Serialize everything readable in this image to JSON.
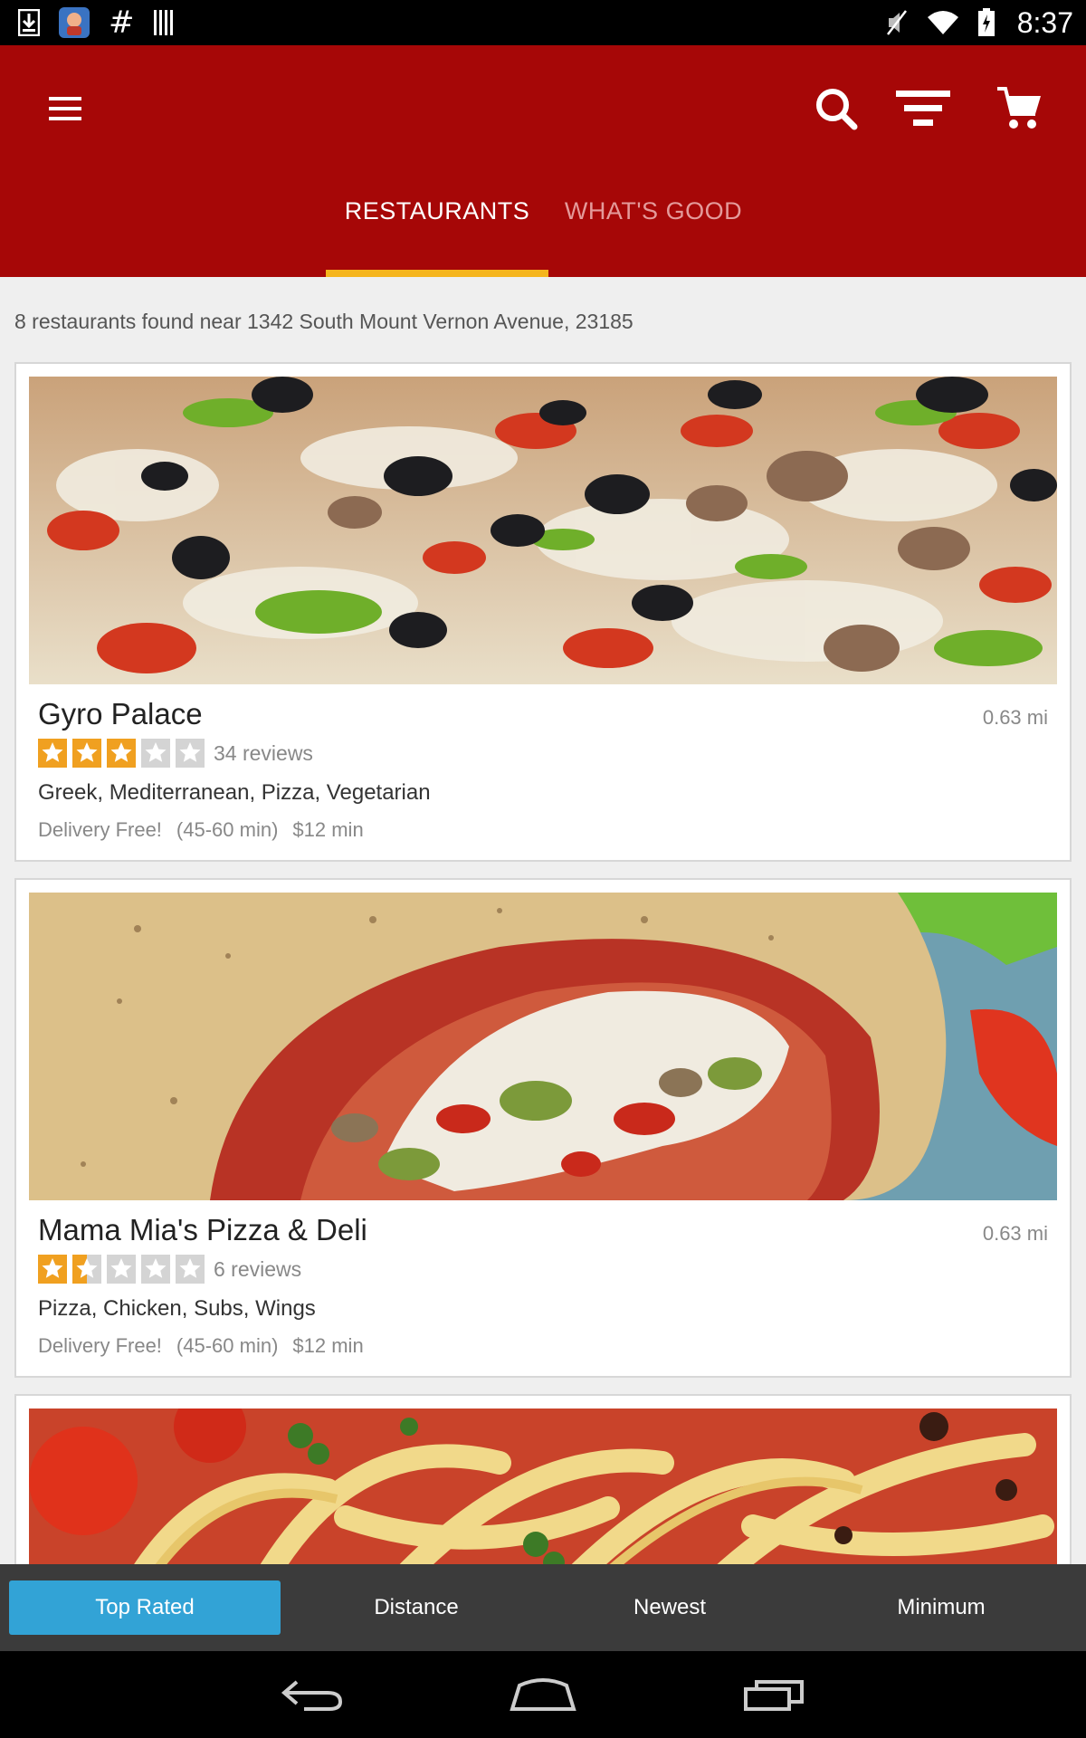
{
  "status_bar": {
    "time": "8:37",
    "icons": [
      "download-icon",
      "app-icon",
      "hash-icon",
      "barcode-icon",
      "mute-icon",
      "wifi-icon",
      "battery-icon"
    ]
  },
  "app_bar": {
    "background": "#a60707",
    "accent": "#f5b51d",
    "icons": [
      "menu-icon",
      "search-icon",
      "filter-icon",
      "cart-icon"
    ],
    "tabs": [
      {
        "label": "RESTAURANTS",
        "selected": true
      },
      {
        "label": "WHAT'S GOOD",
        "selected": false
      }
    ]
  },
  "results_summary": "8 restaurants found near 1342 South Mount Vernon Avenue, 23185",
  "restaurants": [
    {
      "name": "Gyro Palace",
      "distance": "0.63 mi",
      "rating": 3,
      "rating_max": 5,
      "reviews": "34 reviews",
      "cuisines": "Greek, Mediterranean, Pizza, Vegetarian",
      "delivery": "Delivery Free!",
      "time": "(45-60 min)",
      "minimum": "$12 min",
      "photo": "pizza-photo"
    },
    {
      "name": "Mama Mia's Pizza & Deli",
      "distance": "0.63 mi",
      "rating": 1.5,
      "rating_max": 5,
      "reviews": "6 reviews",
      "cuisines": "Pizza, Chicken, Subs, Wings",
      "delivery": "Delivery Free!",
      "time": "(45-60 min)",
      "minimum": "$12 min",
      "photo": "stromboli-photo"
    },
    {
      "photo": "pasta-photo"
    }
  ],
  "sort_bar": {
    "options": [
      {
        "label": "Top Rated",
        "selected": true
      },
      {
        "label": "Distance",
        "selected": false
      },
      {
        "label": "Newest",
        "selected": false
      },
      {
        "label": "Minimum",
        "selected": false
      }
    ],
    "selected_color": "#32a3d6"
  },
  "nav_bar": {
    "icons": [
      "back-icon",
      "home-icon",
      "recents-icon"
    ]
  }
}
